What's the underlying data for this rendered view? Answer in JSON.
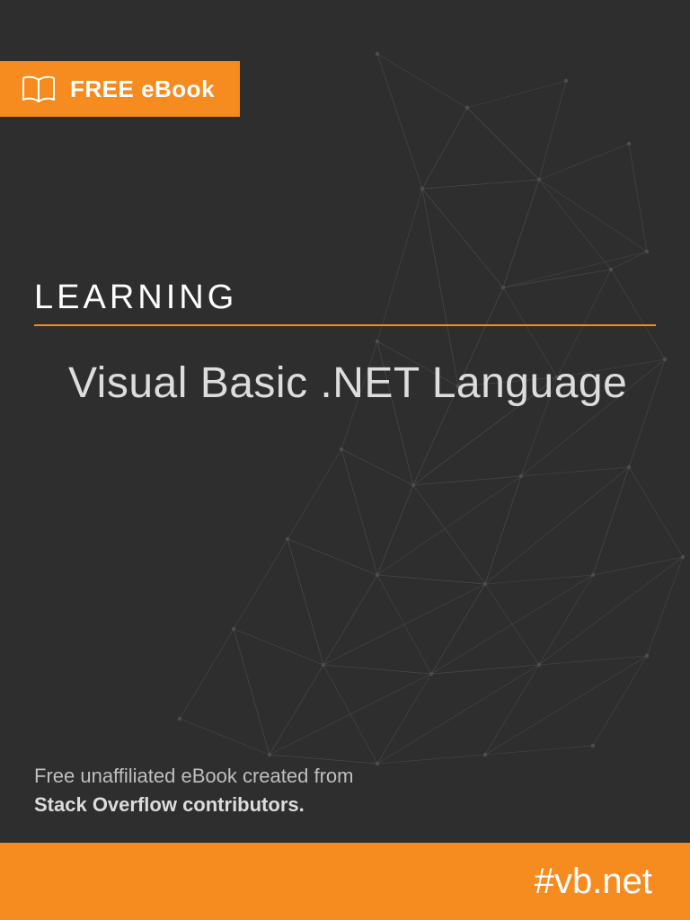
{
  "badge": {
    "label": "FREE eBook"
  },
  "title": {
    "kicker": "LEARNING",
    "subject": "Visual Basic .NET Language"
  },
  "credit": {
    "line1": "Free unaffiliated eBook created from",
    "line2": "Stack Overflow contributors."
  },
  "hashtag": "#vb.net",
  "colors": {
    "accent": "#f68b1f",
    "bg": "#2e2e2e"
  }
}
